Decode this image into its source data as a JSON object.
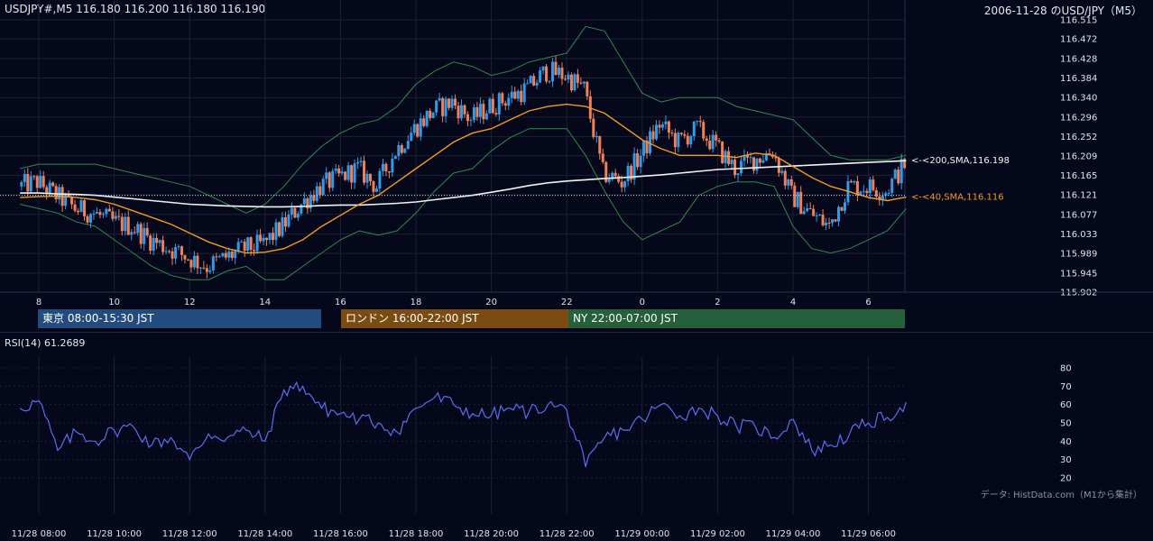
{
  "header": {
    "symbol_quote": "USDJPY#,M5 116.180 116.200 116.180 116.190",
    "chart_title": "2006-11-28 のUSD/JPY（M5）"
  },
  "colors": {
    "background": "#05081a",
    "grid": "#1a2036",
    "bull": "#2f9bea",
    "bear": "#f0805a",
    "sma40": "#f39a25",
    "sma200": "#f2f2f2",
    "bollinger": "#2f8a4b",
    "rsi": "#5a6ef0",
    "tokyo": "#234c7e",
    "london": "#7a4c12",
    "ny": "#25603b"
  },
  "chart_data": [
    {
      "type": "candlestick",
      "symbol": "USDJPY",
      "timeframe": "M5",
      "ylim": [
        115.902,
        116.515
      ],
      "y_ticks": [
        "116.515",
        "116.472",
        "116.428",
        "116.384",
        "116.340",
        "116.296",
        "116.252",
        "116.209",
        "116.165",
        "116.121",
        "116.077",
        "116.033",
        "115.989",
        "115.945",
        "115.902"
      ],
      "x_ticks": [
        "8",
        "10",
        "12",
        "14",
        "16",
        "18",
        "20",
        "22",
        "0",
        "2",
        "4",
        "6"
      ],
      "last_price": 116.19,
      "hours": [
        7.5,
        8,
        8.5,
        9,
        9.5,
        10,
        10.5,
        11,
        11.5,
        12,
        12.5,
        13,
        13.5,
        14,
        14.5,
        15,
        15.5,
        16,
        16.5,
        17,
        17.5,
        18,
        18.5,
        19,
        19.5,
        20,
        20.5,
        21,
        21.5,
        22,
        22.5,
        23,
        23.5,
        24,
        24.5,
        25,
        25.5,
        26,
        26.5,
        27,
        27.5,
        28,
        28.5,
        29,
        29.5,
        30,
        30.5,
        31
      ],
      "series": [
        {
          "name": "SMA 40",
          "label": "<-<200,SMA,116.198"
        },
        {
          "name": "SMA 200",
          "label": "<-<40,SMA,116.116"
        }
      ],
      "sma200_label": "<-<200,SMA,116.198",
      "sma40_label": "<-<40,SMA,116.116",
      "close": [
        116.14,
        116.15,
        116.12,
        116.09,
        116.08,
        116.06,
        116.05,
        116.02,
        116.0,
        115.98,
        115.96,
        115.98,
        116.0,
        116.01,
        116.05,
        116.1,
        116.14,
        116.16,
        116.18,
        116.14,
        116.22,
        116.27,
        116.31,
        116.33,
        116.29,
        116.32,
        116.34,
        116.36,
        116.4,
        116.39,
        116.36,
        116.17,
        116.15,
        116.21,
        116.28,
        116.24,
        116.27,
        116.23,
        116.18,
        116.2,
        116.22,
        116.12,
        116.08,
        116.05,
        116.14,
        116.14,
        116.13,
        116.19
      ],
      "sma40": [
        116.115,
        116.117,
        116.118,
        116.115,
        116.11,
        116.1,
        116.085,
        116.07,
        116.055,
        116.035,
        116.015,
        116.0,
        115.99,
        115.992,
        116.0,
        116.02,
        116.05,
        116.075,
        116.1,
        116.12,
        116.15,
        116.18,
        116.21,
        116.24,
        116.26,
        116.27,
        116.29,
        116.31,
        116.32,
        116.325,
        116.32,
        116.305,
        116.275,
        116.245,
        116.225,
        116.21,
        116.21,
        116.21,
        116.205,
        116.215,
        116.21,
        116.185,
        116.16,
        116.14,
        116.128,
        116.115,
        116.108,
        116.116
      ],
      "sma200": [
        116.125,
        116.125,
        116.123,
        116.122,
        116.12,
        116.116,
        116.112,
        116.108,
        116.104,
        116.1,
        116.098,
        116.096,
        116.095,
        116.094,
        116.094,
        116.095,
        116.097,
        116.098,
        116.098,
        116.1,
        116.102,
        116.105,
        116.11,
        116.115,
        116.12,
        116.127,
        116.134,
        116.142,
        116.148,
        116.152,
        116.155,
        116.158,
        116.16,
        116.163,
        116.166,
        116.17,
        116.174,
        116.178,
        116.18,
        116.182,
        116.184,
        116.186,
        116.188,
        116.19,
        116.192,
        116.194,
        116.196,
        116.198
      ],
      "bb_upper": [
        116.18,
        116.19,
        116.19,
        116.19,
        116.19,
        116.18,
        116.17,
        116.16,
        116.15,
        116.14,
        116.12,
        116.1,
        116.08,
        116.1,
        116.14,
        116.19,
        116.23,
        116.26,
        116.28,
        116.29,
        116.32,
        116.37,
        116.4,
        116.42,
        116.41,
        116.39,
        116.4,
        116.42,
        116.43,
        116.44,
        116.5,
        116.49,
        116.42,
        116.35,
        116.33,
        116.34,
        116.34,
        116.34,
        116.32,
        116.31,
        116.3,
        116.29,
        116.25,
        116.21,
        116.2,
        116.2,
        116.2,
        116.21
      ],
      "bb_lower": [
        116.1,
        116.09,
        116.08,
        116.06,
        116.05,
        116.02,
        115.99,
        115.96,
        115.94,
        115.93,
        115.93,
        115.95,
        115.96,
        115.93,
        115.93,
        115.96,
        115.99,
        116.02,
        116.04,
        116.03,
        116.04,
        116.08,
        116.13,
        116.17,
        116.18,
        116.22,
        116.25,
        116.27,
        116.27,
        116.27,
        116.21,
        116.13,
        116.06,
        116.02,
        116.04,
        116.06,
        116.12,
        116.14,
        116.15,
        116.15,
        116.14,
        116.05,
        116.0,
        115.99,
        116.0,
        116.02,
        116.04,
        116.09
      ]
    },
    {
      "type": "line",
      "indicator": "RSI(14)",
      "value_label": "RSI(14) 61.2689",
      "ylim": [
        20,
        80
      ],
      "y_ticks": [
        "80",
        "70",
        "60",
        "50",
        "40",
        "30",
        "20"
      ],
      "x_ticks": [
        "11/28 08:00",
        "11/28 10:00",
        "11/28 12:00",
        "11/28 14:00",
        "11/28 16:00",
        "11/28 18:00",
        "11/28 20:00",
        "11/28 22:00",
        "11/29 00:00",
        "11/29 02:00",
        "11/29 04:00",
        "11/29 06:00"
      ],
      "hours": [
        7.5,
        8,
        8.5,
        9,
        9.5,
        10,
        10.5,
        11,
        11.5,
        12,
        12.5,
        13,
        13.5,
        14,
        14.5,
        15,
        15.5,
        16,
        16.5,
        17,
        17.5,
        18,
        18.5,
        19,
        19.5,
        20,
        20.5,
        21,
        21.5,
        22,
        22.5,
        23,
        23.5,
        24,
        24.5,
        25,
        25.5,
        26,
        26.5,
        27,
        27.5,
        28,
        28.5,
        29,
        29.5,
        30,
        30.5,
        31
      ],
      "values": [
        58,
        62,
        35,
        45,
        40,
        46,
        48,
        38,
        42,
        30,
        44,
        42,
        46,
        40,
        68,
        70,
        58,
        55,
        52,
        50,
        45,
        58,
        64,
        60,
        55,
        54,
        58,
        56,
        60,
        57,
        26,
        42,
        46,
        52,
        60,
        54,
        58,
        54,
        48,
        48,
        42,
        52,
        35,
        38,
        44,
        50,
        53,
        61.3
      ]
    }
  ],
  "sessions": [
    {
      "label": "東京 08:00-15:30 JST"
    },
    {
      "label": "ロンドン 16:00-22:00 JST"
    },
    {
      "label": "NY 22:00-07:00 JST"
    }
  ],
  "footer": {
    "source": "データ: HistData.com（M1から集計）"
  }
}
